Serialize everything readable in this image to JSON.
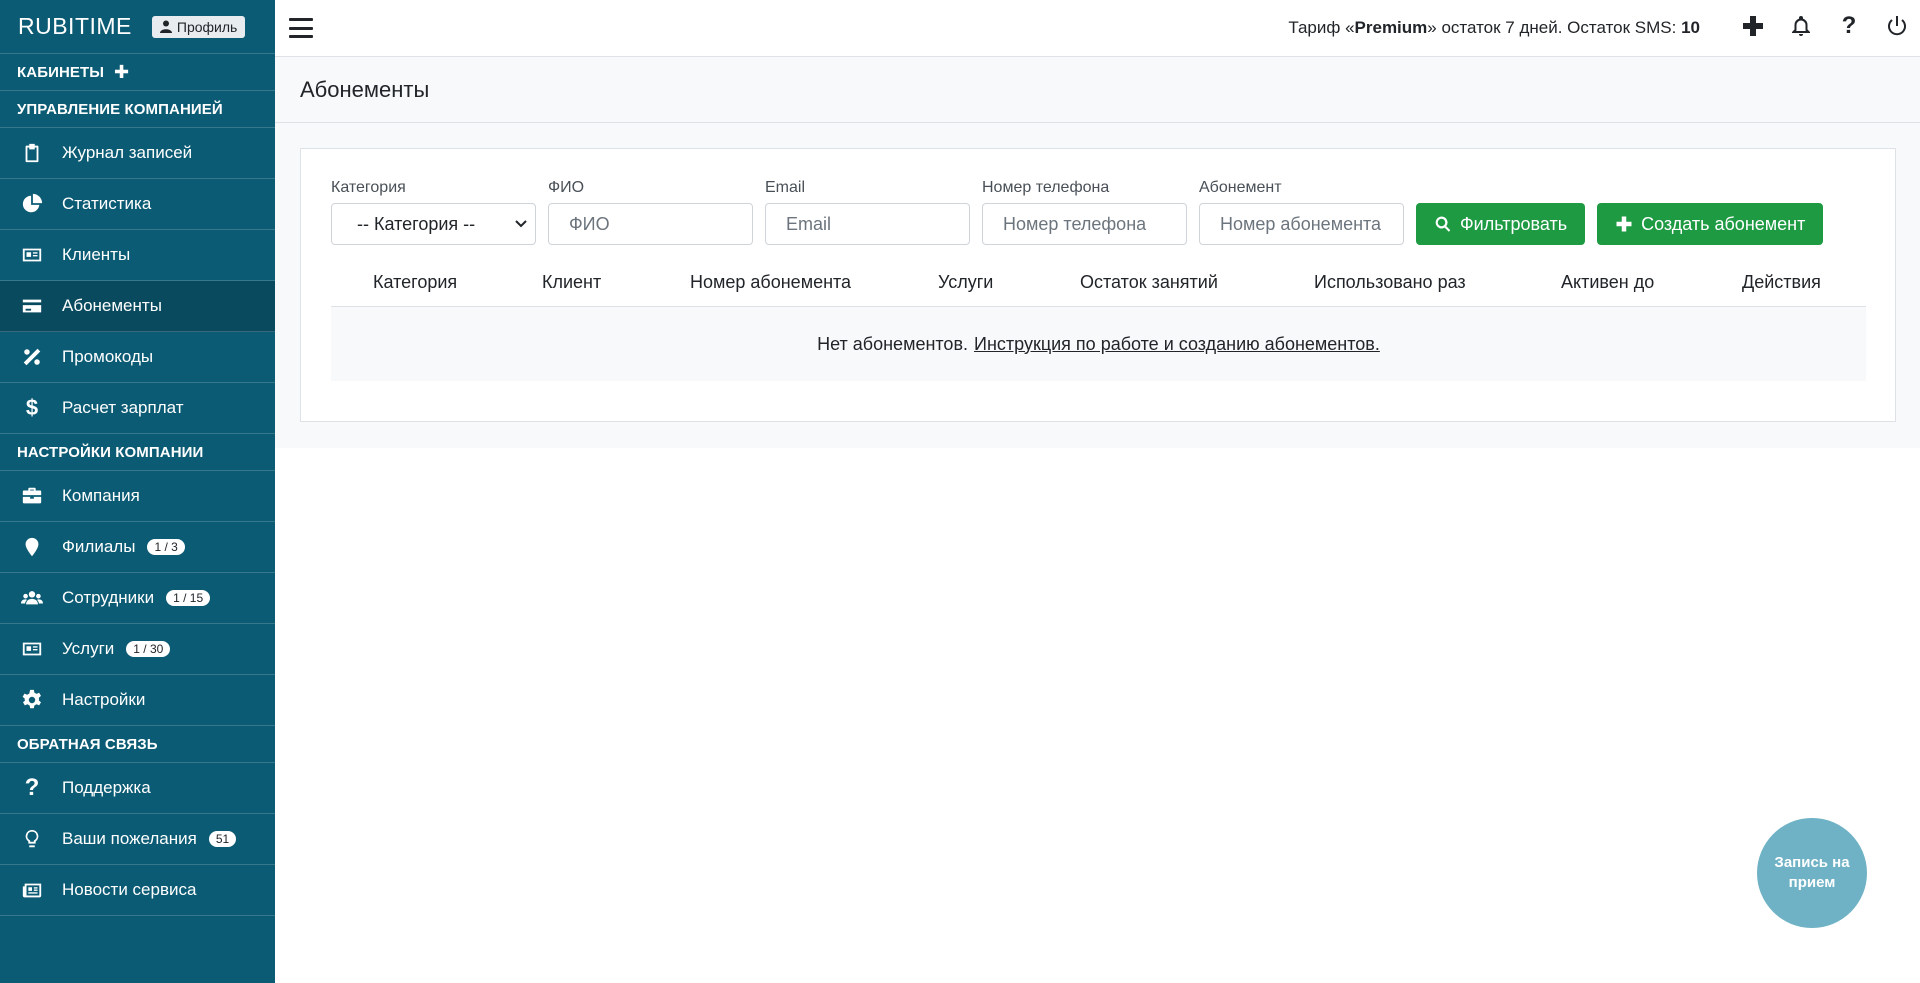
{
  "brand": {
    "name": "RUBITIME",
    "profile_label": "Профиль"
  },
  "sidebar": {
    "cabinets_label": "КАБИНЕТЫ",
    "sections": [
      {
        "title": "УПРАВЛЕНИЕ КОМПАНИЕЙ",
        "items": [
          {
            "label": "Журнал записей",
            "icon": "clipboard-icon"
          },
          {
            "label": "Статистика",
            "icon": "pie-chart-icon"
          },
          {
            "label": "Клиенты",
            "icon": "id-card-icon"
          },
          {
            "label": "Абонементы",
            "icon": "credit-card-icon",
            "active": true
          },
          {
            "label": "Промокоды",
            "icon": "percent-icon"
          },
          {
            "label": "Расчет зарплат",
            "icon": "dollar-icon"
          }
        ]
      },
      {
        "title": "НАСТРОЙКИ КОМПАНИИ",
        "items": [
          {
            "label": "Компания",
            "icon": "briefcase-icon"
          },
          {
            "label": "Филиалы",
            "icon": "map-marker-icon",
            "badge": "1 / 3"
          },
          {
            "label": "Сотрудники",
            "icon": "users-icon",
            "badge": "1 / 15"
          },
          {
            "label": "Услуги",
            "icon": "id-card-icon",
            "badge": "1 / 30"
          },
          {
            "label": "Настройки",
            "icon": "gear-icon"
          }
        ]
      },
      {
        "title": "ОБРАТНАЯ СВЯЗЬ",
        "items": [
          {
            "label": "Поддержка",
            "icon": "question-icon"
          },
          {
            "label": "Ваши пожелания",
            "icon": "lightbulb-icon",
            "badge": "51"
          },
          {
            "label": "Новости сервиса",
            "icon": "newspaper-icon"
          }
        ]
      }
    ]
  },
  "topbar": {
    "tariff_prefix": "Тариф «",
    "tariff_name": "Premium",
    "tariff_suffix": "» остаток 7 дней. Остаток SMS: ",
    "sms_count": "10"
  },
  "page": {
    "title": "Абонементы"
  },
  "filters": {
    "category_label": "Категория",
    "category_value": "-- Категория --",
    "fio_label": "ФИО",
    "fio_placeholder": "ФИО",
    "email_label": "Email",
    "email_placeholder": "Email",
    "phone_label": "Номер телефона",
    "phone_placeholder": "Номер телефона",
    "subscription_label": "Абонемент",
    "subscription_placeholder": "Номер абонемента",
    "filter_button": "Фильтровать",
    "create_button": "Создать абонемент"
  },
  "table": {
    "columns": [
      "Категория",
      "Клиент",
      "Номер абонемента",
      "Услуги",
      "Остаток занятий",
      "Использовано раз",
      "Активен до",
      "Действия"
    ],
    "empty_text": "Нет абонементов.",
    "empty_link": "Инструкция по работе и созданию абонементов."
  },
  "fab": {
    "label": "Запись на прием"
  },
  "colors": {
    "sidebar": "#0c5b74",
    "accent_green": "#1e9a43",
    "fab": "#6fb2c5"
  }
}
